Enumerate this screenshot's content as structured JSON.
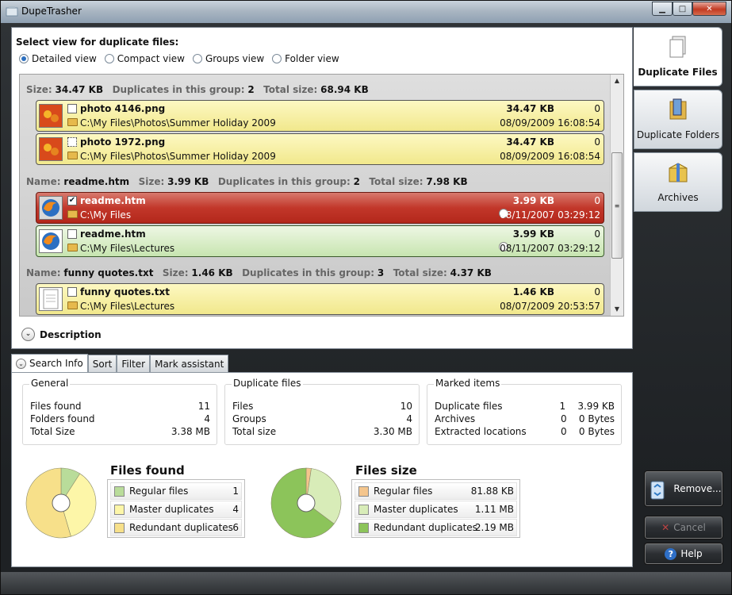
{
  "window": {
    "title": "DupeTrasher"
  },
  "view": {
    "title": "Select view for duplicate files:",
    "options": [
      "Detailed view",
      "Compact view",
      "Groups view",
      "Folder view"
    ],
    "selected": "Detailed view"
  },
  "list": {
    "groups": [
      {
        "header": {
          "size_label": "Size:",
          "size": "34.47 KB",
          "dup_label": "Duplicates in this group:",
          "dup": "2",
          "total_label": "Total size:",
          "total": "68.94 KB"
        },
        "files": [
          {
            "name": "photo 4146.png",
            "path": "C:\\My Files\\Photos\\Summer Holiday 2009",
            "size": "34.47 KB",
            "count": "0",
            "date": "08/09/2009 16:08:54",
            "checked": false,
            "style": "yellow"
          },
          {
            "name": "photo 1972.png",
            "path": "C:\\My Files\\Photos\\Summer Holiday 2009",
            "size": "34.47 KB",
            "count": "0",
            "date": "08/09/2009 16:08:54",
            "checked": false,
            "style": "yellow"
          }
        ]
      },
      {
        "header": {
          "name_label": "Name:",
          "name": "readme.htm",
          "size_label": "Size:",
          "size": "3.99 KB",
          "dup_label": "Duplicates in this group:",
          "dup": "2",
          "total_label": "Total size:",
          "total": "7.98 KB"
        },
        "files": [
          {
            "name": "readme.htm",
            "path": "C:\\My Files",
            "size": "3.99 KB",
            "count": "0",
            "date": "08/11/2007 03:29:12",
            "checked": true,
            "style": "red"
          },
          {
            "name": "readme.htm",
            "path": "C:\\My Files\\Lectures",
            "size": "3.99 KB",
            "count": "0",
            "date": "08/11/2007 03:29:12",
            "checked": false,
            "style": "green"
          }
        ]
      },
      {
        "header": {
          "name_label": "Name:",
          "name": "funny quotes.txt",
          "size_label": "Size:",
          "size": "1.46 KB",
          "dup_label": "Duplicates in this group:",
          "dup": "3",
          "total_label": "Total size:",
          "total": "4.37 KB"
        },
        "files": [
          {
            "name": "funny quotes.txt",
            "path": "C:\\My Files\\Lectures",
            "size": "1.46 KB",
            "count": "0",
            "date": "08/07/2009 20:53:57",
            "checked": false,
            "style": "yellow"
          }
        ]
      }
    ]
  },
  "description": {
    "label": "Description"
  },
  "side_tabs": [
    {
      "label": "Duplicate Files",
      "icon": "duplicate-files-icon",
      "active": true
    },
    {
      "label": "Duplicate Folders",
      "icon": "duplicate-folders-icon",
      "active": false
    },
    {
      "label": "Archives",
      "icon": "archives-icon",
      "active": false
    }
  ],
  "bottom_tabs": [
    "Search Info",
    "Sort",
    "Filter",
    "Mark assistant"
  ],
  "search_info": {
    "general": {
      "title": "General",
      "rows": [
        [
          "Files found",
          "11"
        ],
        [
          "Folders found",
          "4"
        ],
        [
          "Total Size",
          "3.38 MB"
        ]
      ]
    },
    "duplicate_files": {
      "title": "Duplicate files",
      "rows": [
        [
          "Files",
          "10"
        ],
        [
          "Groups",
          "4"
        ],
        [
          "Total size",
          "3.30 MB"
        ]
      ]
    },
    "marked_items": {
      "title": "Marked items",
      "rows": [
        [
          "Duplicate files",
          "1",
          "3.99 KB"
        ],
        [
          "Archives",
          "0",
          "0 Bytes"
        ],
        [
          "Extracted locations",
          "0",
          "0 Bytes"
        ]
      ]
    }
  },
  "chart_data": [
    {
      "type": "pie",
      "title": "Files found",
      "categories": [
        "Regular files",
        "Master duplicates",
        "Redundant duplicates"
      ],
      "values": [
        1,
        4,
        6
      ],
      "labels": [
        "1",
        "4",
        "6"
      ],
      "colors": [
        "#b9dc9a",
        "#fdf6a8",
        "#f7e08a"
      ]
    },
    {
      "type": "pie",
      "title": "Files size",
      "categories": [
        "Regular files",
        "Master duplicates",
        "Redundant duplicates"
      ],
      "values": [
        81.88,
        1136.64,
        2242.56
      ],
      "labels": [
        "81.88 KB",
        "1.11 MB",
        "2.19 MB"
      ],
      "colors": [
        "#f4c58c",
        "#d8ecb8",
        "#8cc45a"
      ]
    }
  ],
  "actions": {
    "remove": "Remove...",
    "cancel": "Cancel",
    "help": "Help"
  }
}
